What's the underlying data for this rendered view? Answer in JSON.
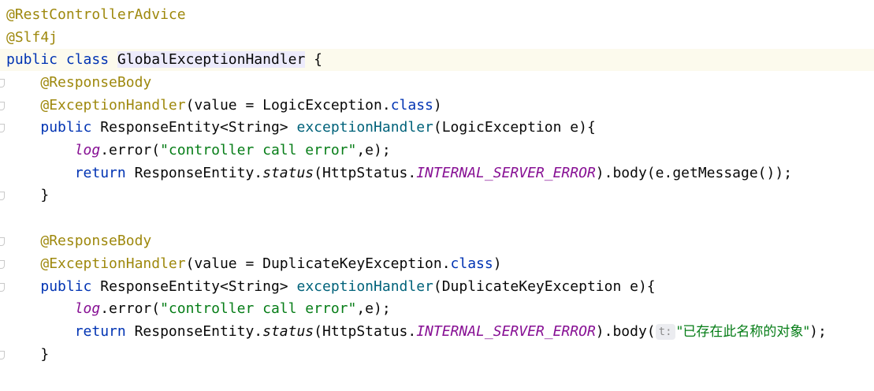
{
  "code": {
    "l1_annotation": "@RestControllerAdvice",
    "l2_annotation": "@Slf4j",
    "l3_public": "public",
    "l3_class": "class",
    "l3_class_name": "GlobalExceptionHandler",
    "l3_brace": " {",
    "h1": {
      "response_body": "@ResponseBody",
      "exception_handler": "@ExceptionHandler",
      "value_open": "(value = LogicException.",
      "class_kw": "class",
      "close_paren": ")",
      "public_kw": "public",
      "return_type": " ResponseEntity<String> ",
      "method_name": "exceptionHandler",
      "params": "(LogicException e){",
      "log_field": "log",
      "error_call": ".error(",
      "log_message": "\"controller call error\"",
      "log_args_end": ",e);",
      "return_kw": "return",
      "response_entity": " ResponseEntity.",
      "status_call": "status",
      "http_status": "(HttpStatus.",
      "status_const": "INTERNAL_SERVER_ERROR",
      "body_call": ").body(e.getMessage());",
      "close_brace": "}"
    },
    "h2": {
      "response_body": "@ResponseBody",
      "exception_handler": "@ExceptionHandler",
      "value_open": "(value = DuplicateKeyException.",
      "class_kw": "class",
      "close_paren": ")",
      "public_kw": "public",
      "return_type": " ResponseEntity<String> ",
      "method_name": "exceptionHandler",
      "params": "(DuplicateKeyException e){",
      "log_field": "log",
      "error_call": ".error(",
      "log_message": "\"controller call error\"",
      "log_args_end": ",e);",
      "return_kw": "return",
      "response_entity": " ResponseEntity.",
      "status_call": "status",
      "http_status": "(HttpStatus.",
      "status_const": "INTERNAL_SERVER_ERROR",
      "body_open": ").body(",
      "param_hint": "t:",
      "body_string": "\"已存在此名称的对象\"",
      "body_close": ");",
      "close_brace": "}"
    }
  },
  "colors": {
    "annotation": "#9e880d",
    "keyword": "#0033b3",
    "method": "#00627a",
    "string": "#067d17",
    "constant": "#871094",
    "current_line": "#fcfaed"
  },
  "icons": {
    "fold": "fold-marker-icon"
  }
}
